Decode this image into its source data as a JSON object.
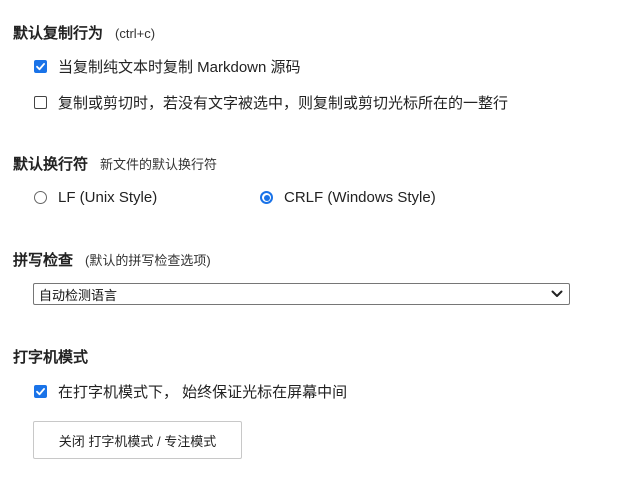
{
  "copy": {
    "title": "默认复制行为",
    "subtitle": "(ctrl+c)",
    "options": [
      {
        "label": "当复制纯文本时复制 Markdown 源码",
        "checked": true
      },
      {
        "label": "复制或剪切时，若没有文字被选中，则复制或剪切光标所在的一整行",
        "checked": false
      }
    ]
  },
  "linebreak": {
    "title": "默认换行符",
    "subtitle": "新文件的默认换行符",
    "options": [
      {
        "label": "LF (Unix Style)",
        "selected": false
      },
      {
        "label": "CRLF (Windows Style)",
        "selected": true
      }
    ]
  },
  "spellcheck": {
    "title": "拼写检查",
    "subtitle": "(默认的拼写检查选项)",
    "selected": "自动检测语言"
  },
  "typewriter": {
    "title": "打字机模式",
    "option": {
      "label": "在打字机模式下， 始终保证光标在屏幕中间",
      "checked": true
    },
    "button_label": "关闭 打字机模式 / 专注模式"
  },
  "colors": {
    "accent": "#1a73e8"
  },
  "icons": {
    "checkbox_checked": "check-icon",
    "select_arrow": "chevron-down-icon"
  }
}
